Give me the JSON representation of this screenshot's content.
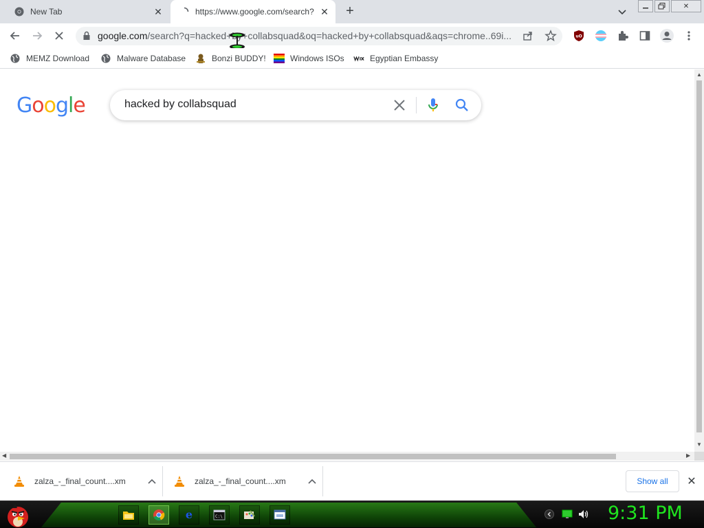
{
  "tabs": [
    {
      "title": "New Tab",
      "active": false
    },
    {
      "title": "https://www.google.com/search?",
      "active": true
    }
  ],
  "toolbar": {
    "url_host": "google.com",
    "url_path": "/search?q=hacked+by+collabsquad&oq=hacked+by+collabsquad&aqs=chrome..69i..."
  },
  "bookmarks": [
    {
      "label": "MEMZ Download",
      "icon": "globe-icon"
    },
    {
      "label": "Malware Database",
      "icon": "globe-icon"
    },
    {
      "label": "Bonzi BUDDY!",
      "icon": "bonzi-icon"
    },
    {
      "label": "Windows ISOs",
      "icon": "windows-flag-icon"
    },
    {
      "label": "Egyptian Embassy",
      "icon": "wix-icon"
    }
  ],
  "google": {
    "logo": [
      "G",
      "o",
      "o",
      "g",
      "l",
      "e"
    ],
    "logo_colors": [
      "#4285F4",
      "#EA4335",
      "#FBBC05",
      "#4285F4",
      "#34A853",
      "#EA4335"
    ],
    "query": "hacked by collabsquad"
  },
  "downloads": [
    {
      "name": "zalza_-_final_count....xm",
      "icon": "vlc-icon"
    },
    {
      "name": "zalza_-_final_count....xm",
      "icon": "vlc-icon"
    }
  ],
  "download_bar": {
    "show_all": "Show all"
  },
  "taskbar": {
    "clock": "9:31 PM",
    "clock_color": "#1fe61f"
  }
}
